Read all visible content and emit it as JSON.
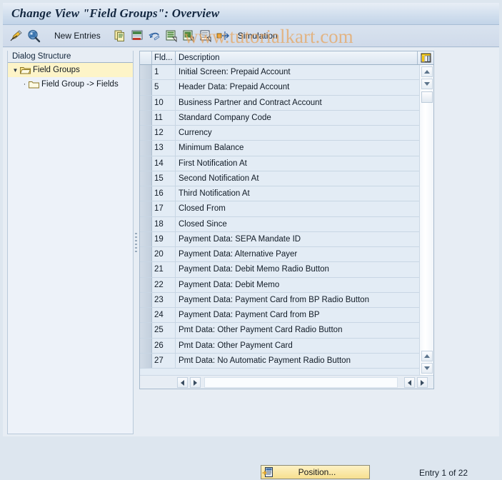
{
  "window": {
    "title": "Change View \"Field Groups\": Overview"
  },
  "watermark": "www.tutorialkart.com",
  "toolbar": {
    "buttons": [
      {
        "name": "display-change-icon",
        "tooltip": "Display <-> Change"
      },
      {
        "name": "check-entries-icon",
        "tooltip": "Check Entries"
      }
    ],
    "new_entries_label": "New Entries",
    "action_icons": [
      {
        "name": "copy-as-icon",
        "tooltip": "Copy As..."
      },
      {
        "name": "delete-icon",
        "tooltip": "Delete"
      },
      {
        "name": "undo-icon",
        "tooltip": "Undo Change"
      },
      {
        "name": "select-all-icon",
        "tooltip": "Select All"
      },
      {
        "name": "select-block-icon",
        "tooltip": "Select Block"
      },
      {
        "name": "deselect-all-icon",
        "tooltip": "Deselect All"
      },
      {
        "name": "transport-icon",
        "tooltip": "Transport"
      }
    ],
    "simulation_label": "Simulation"
  },
  "dialog_structure": {
    "header": "Dialog Structure",
    "items": [
      {
        "label": "Field Groups",
        "level": 0,
        "selected": true,
        "expanded": true,
        "icon": "open-folder-icon"
      },
      {
        "label": "Field Group -> Fields",
        "level": 1,
        "selected": false,
        "expanded": false,
        "icon": "closed-folder-icon"
      }
    ]
  },
  "table": {
    "columns": [
      "Fld...",
      "Description"
    ],
    "config_icon": "table-settings-icon",
    "rows": [
      {
        "fld": "1",
        "description": "Initial Screen: Prepaid Account"
      },
      {
        "fld": "5",
        "description": "Header Data: Prepaid Account"
      },
      {
        "fld": "10",
        "description": "Business Partner and Contract Account"
      },
      {
        "fld": "11",
        "description": "Standard Company Code"
      },
      {
        "fld": "12",
        "description": "Currency"
      },
      {
        "fld": "13",
        "description": "Minimum Balance"
      },
      {
        "fld": "14",
        "description": "First Notification At"
      },
      {
        "fld": "15",
        "description": "Second Notification At"
      },
      {
        "fld": "16",
        "description": "Third Notification At"
      },
      {
        "fld": "17",
        "description": "Closed From"
      },
      {
        "fld": "18",
        "description": "Closed Since"
      },
      {
        "fld": "19",
        "description": "Payment Data: SEPA Mandate ID"
      },
      {
        "fld": "20",
        "description": "Payment Data: Alternative Payer"
      },
      {
        "fld": "21",
        "description": "Payment Data: Debit Memo Radio Button"
      },
      {
        "fld": "22",
        "description": "Payment Data: Debit Memo"
      },
      {
        "fld": "23",
        "description": "Payment Data: Payment Card from BP Radio Button"
      },
      {
        "fld": "24",
        "description": "Payment Data: Payment Card from BP"
      },
      {
        "fld": "25",
        "description": "Pmt Data: Other Payment Card Radio Button"
      },
      {
        "fld": "26",
        "description": "Pmt Data: Other Payment Card"
      },
      {
        "fld": "27",
        "description": "Pmt Data: No Automatic Payment Radio Button"
      }
    ]
  },
  "footer": {
    "position_label": "Position...",
    "entry_count": "Entry 1 of 22"
  },
  "colors": {
    "title_text": "#12263f",
    "watermark": "#e8a45c",
    "tree_selected_bg": "#fdf4c8",
    "button_bg": "#f7e08f",
    "row_bg": "#e3ecf5"
  }
}
